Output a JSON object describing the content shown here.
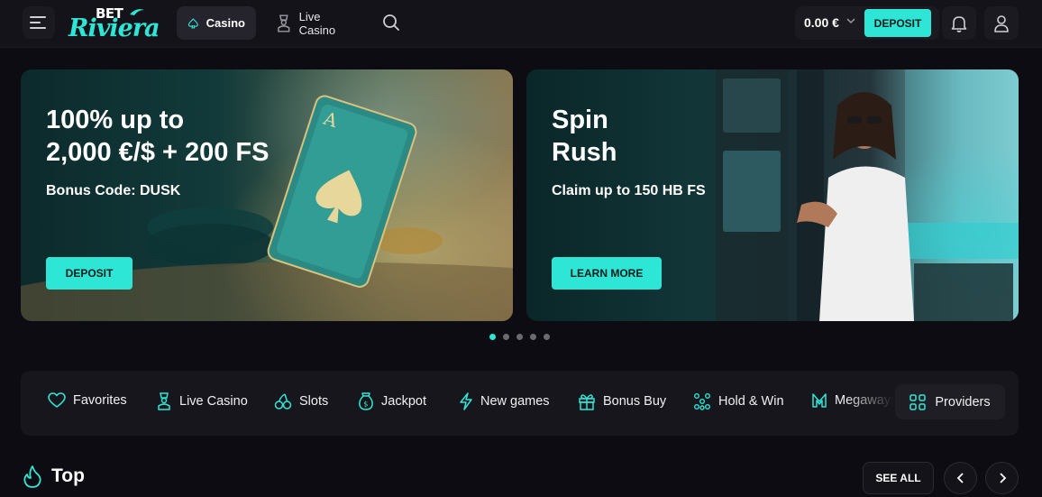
{
  "header": {
    "logo_top": "BET",
    "logo_bottom": "Riviera",
    "tabs": [
      {
        "label": "Casino",
        "icon": "spade-icon",
        "active": true
      },
      {
        "label": "Live Casino",
        "icon": "dealer-icon",
        "active": false
      }
    ],
    "balance": "0.00 €",
    "deposit_label": "DEPOSIT"
  },
  "banners": [
    {
      "title_line1": "100% up to",
      "title_line2": "2,000 €/$ + 200 FS",
      "subtitle": "Bonus Code: DUSK",
      "button": "DEPOSIT"
    },
    {
      "title_line1": "Spin",
      "title_line2": "Rush",
      "subtitle": "Claim up to 150 HB FS",
      "button": "LEARN MORE"
    }
  ],
  "carousel": {
    "total": 5,
    "active": 1
  },
  "categories": [
    {
      "label": "Favorites",
      "icon": "heart-icon"
    },
    {
      "label": "Live Casino",
      "icon": "dealer-icon"
    },
    {
      "label": "Slots",
      "icon": "cherries-icon"
    },
    {
      "label": "Jackpot",
      "icon": "money-bag-icon"
    },
    {
      "label": "New games",
      "icon": "lightning-icon"
    },
    {
      "label": "Bonus Buy",
      "icon": "gift-icon"
    },
    {
      "label": "Hold & Win",
      "icon": "dots-icon"
    },
    {
      "label": "Megaways",
      "icon": "m-icon"
    }
  ],
  "providers_label": "Providers",
  "top_section": {
    "title": "Top",
    "see_all": "SEE ALL"
  },
  "colors": {
    "accent": "#2ee6d6",
    "background": "#0d0c12",
    "header": "#141319"
  }
}
